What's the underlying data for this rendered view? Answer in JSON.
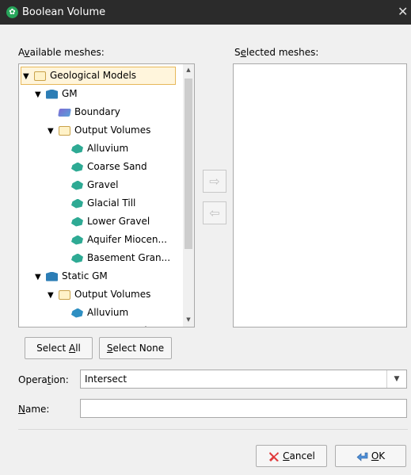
{
  "window": {
    "title": "Boolean Volume",
    "close_glyph": "✕"
  },
  "available_label": {
    "pre": "A",
    "key": "v",
    "post": "ailable meshes:"
  },
  "selected_label": {
    "pre": "S",
    "key": "e",
    "post": "lected meshes:"
  },
  "tree": [
    {
      "label": "Geological Models",
      "icon": "folder-icon",
      "expanded": true,
      "selected": true
    },
    {
      "label": "GM",
      "icon": "geological-model-icon",
      "expanded": true
    },
    {
      "label": "Boundary",
      "icon": "boundary-icon"
    },
    {
      "label": "Output Volumes",
      "icon": "folder-icon",
      "expanded": true
    },
    {
      "label": "Alluvium",
      "icon": "volume-icon"
    },
    {
      "label": "Coarse Sand",
      "icon": "volume-icon"
    },
    {
      "label": "Gravel",
      "icon": "volume-icon"
    },
    {
      "label": "Glacial Till",
      "icon": "volume-icon"
    },
    {
      "label": "Lower Gravel",
      "icon": "volume-icon"
    },
    {
      "label": "Aquifer Miocen...",
      "icon": "volume-icon"
    },
    {
      "label": "Basement Gran...",
      "icon": "volume-icon"
    },
    {
      "label": "Static GM",
      "icon": "geological-model-icon",
      "expanded": true
    },
    {
      "label": "Output Volumes",
      "icon": "folder-icon",
      "expanded": true
    },
    {
      "label": "Alluvium",
      "icon": "volume-icon"
    },
    {
      "label": "Coarse Sand",
      "icon": "volume-icon"
    }
  ],
  "buttons": {
    "add_arrow": "⇨",
    "remove_arrow": "⇦",
    "select_all": {
      "pre": "Select ",
      "key": "A",
      "post": "ll"
    },
    "select_none": {
      "pre": "",
      "key": "S",
      "post": "elect None"
    },
    "cancel": {
      "pre": "",
      "key": "C",
      "post": "ancel"
    },
    "ok": {
      "pre": "",
      "key": "O",
      "post": "K"
    }
  },
  "operation": {
    "pre": "Opera",
    "key": "t",
    "post": "ion:",
    "value": "Intersect",
    "arrow": "▼"
  },
  "name": {
    "pre": "",
    "key": "N",
    "post": "ame:",
    "value": ""
  },
  "tree_scroll": {
    "up": "▲",
    "down": "▼"
  }
}
